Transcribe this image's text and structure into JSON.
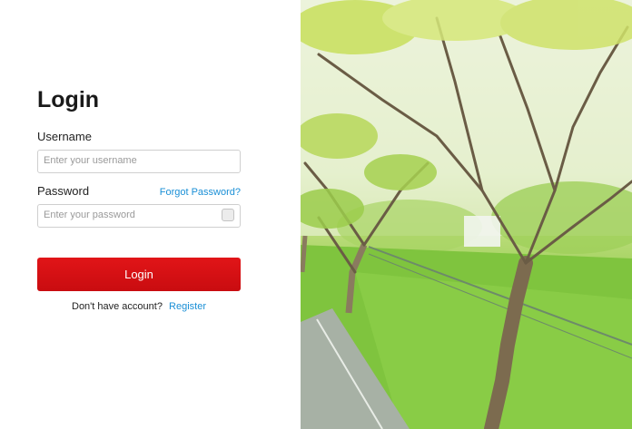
{
  "login": {
    "title": "Login",
    "username_label": "Username",
    "username_placeholder": "Enter your username",
    "password_label": "Password",
    "forgot_password": "Forgot Password?",
    "password_placeholder": "Enter your password",
    "submit_label": "Login",
    "no_account_text": "Don't have account?",
    "register_link": "Register"
  },
  "colors": {
    "accent_red": "#d90f12",
    "link_blue": "#1a8fd6"
  },
  "icons": {
    "show_password": "checkbox"
  }
}
